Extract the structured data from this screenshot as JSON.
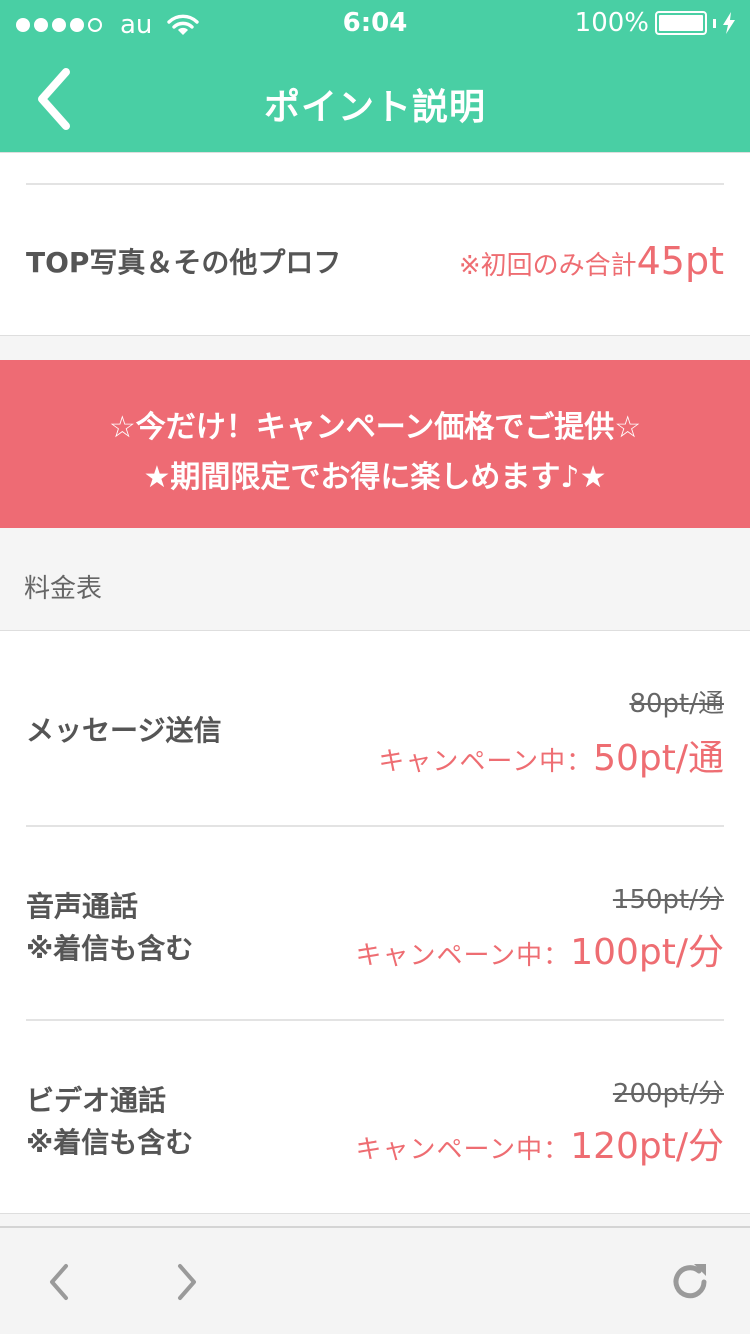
{
  "status_bar": {
    "carrier": "au",
    "time": "6:04",
    "battery_percent": "100%",
    "signal_bars_filled": 4,
    "signal_bars_total": 5
  },
  "nav": {
    "title": "ポイント説明",
    "back_icon": "chevron-left-icon"
  },
  "top_card": {
    "label": "TOP写真＆その他プロフ",
    "price_note": "※初回のみ合計",
    "price_value": "45pt"
  },
  "banner": {
    "line1": "☆今だけ！キャンペーン価格でご提供☆",
    "line2": "★期間限定でお得に楽しめます♪★"
  },
  "price_table": {
    "section_label": "料金表",
    "rows": [
      {
        "label_line1": "メッセージ送信",
        "label_line2": "",
        "old_price": "80pt/通",
        "campaign_label": "キャンペーン中：",
        "campaign_price": "50pt/通"
      },
      {
        "label_line1": "音声通話",
        "label_line2": "※着信も含む",
        "old_price": "150pt/分",
        "campaign_label": "キャンペーン中：",
        "campaign_price": "100pt/分"
      },
      {
        "label_line1": "ビデオ通話",
        "label_line2": "※着信も含む",
        "old_price": "200pt/分",
        "campaign_label": "キャンペーン中：",
        "campaign_price": "120pt/分"
      }
    ]
  },
  "toolbar": {
    "back_icon": "chevron-left-icon",
    "forward_icon": "chevron-right-icon",
    "reload_icon": "reload-icon"
  },
  "colors": {
    "header_green": "#49cfa4",
    "accent_pink": "#ee6b74",
    "price_pink": "#ee6d72"
  }
}
